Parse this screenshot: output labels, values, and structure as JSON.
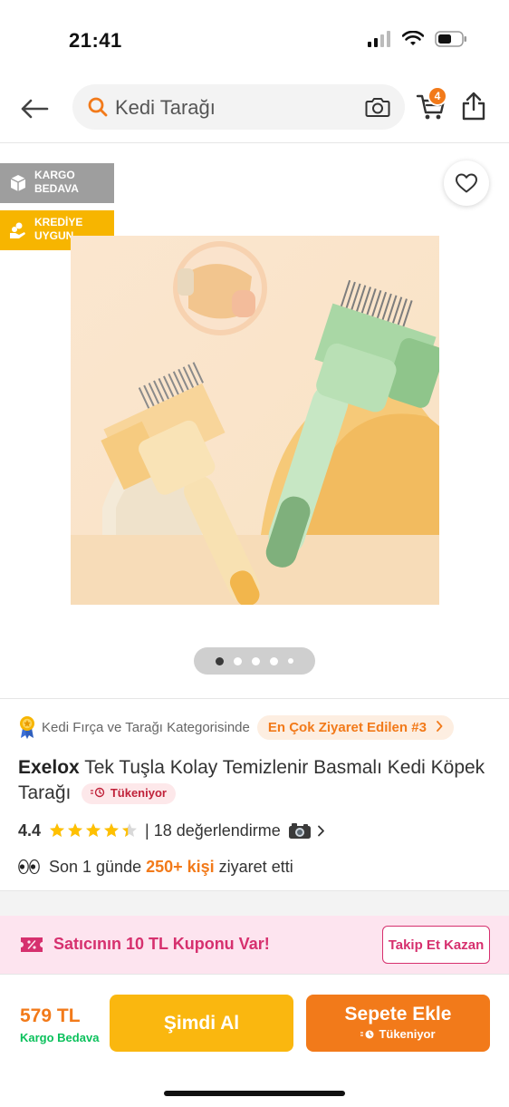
{
  "status_bar": {
    "time": "21:41"
  },
  "search": {
    "query": "Kedi Tarağı"
  },
  "cart": {
    "count": "4"
  },
  "badges": {
    "kargo": [
      "KARGO",
      "BEDAVA"
    ],
    "kredi": [
      "KREDİYE",
      "UYGUN"
    ]
  },
  "gallery": {
    "page_count": 5,
    "active_index": 0
  },
  "category": {
    "text": "Kedi Fırça ve Tarağı Kategorisinde",
    "chip": "En Çok Ziyaret Edilen #3"
  },
  "product": {
    "brand": "Exelox",
    "name": "Tek Tuşla Kolay Temizlenir Basmalı Kedi Köpek Tarağı",
    "stock_label": "Tükeniyor"
  },
  "rating": {
    "score": "4.4",
    "score_value": 4.4,
    "max_stars": 5,
    "reviews": "| 18 değerlendirme"
  },
  "visits": {
    "prefix": "Son 1 günde",
    "highlight": "250+ kişi",
    "suffix": "ziyaret etti"
  },
  "coupon": {
    "text": "Satıcının 10 TL Kuponu Var!",
    "button": "Takip Et Kazan"
  },
  "bottom": {
    "price": "579 TL",
    "shipping": "Kargo Bedava",
    "buy_now": "Şimdi Al",
    "add_to_cart": "Sepete Ekle",
    "add_to_cart_sub": "Tükeniyor"
  },
  "colors": {
    "brand_orange": "#f27a1a",
    "buy_yellow": "#fab70f",
    "coupon_pink": "#d6306e",
    "shipping_green": "#0bc15c"
  }
}
